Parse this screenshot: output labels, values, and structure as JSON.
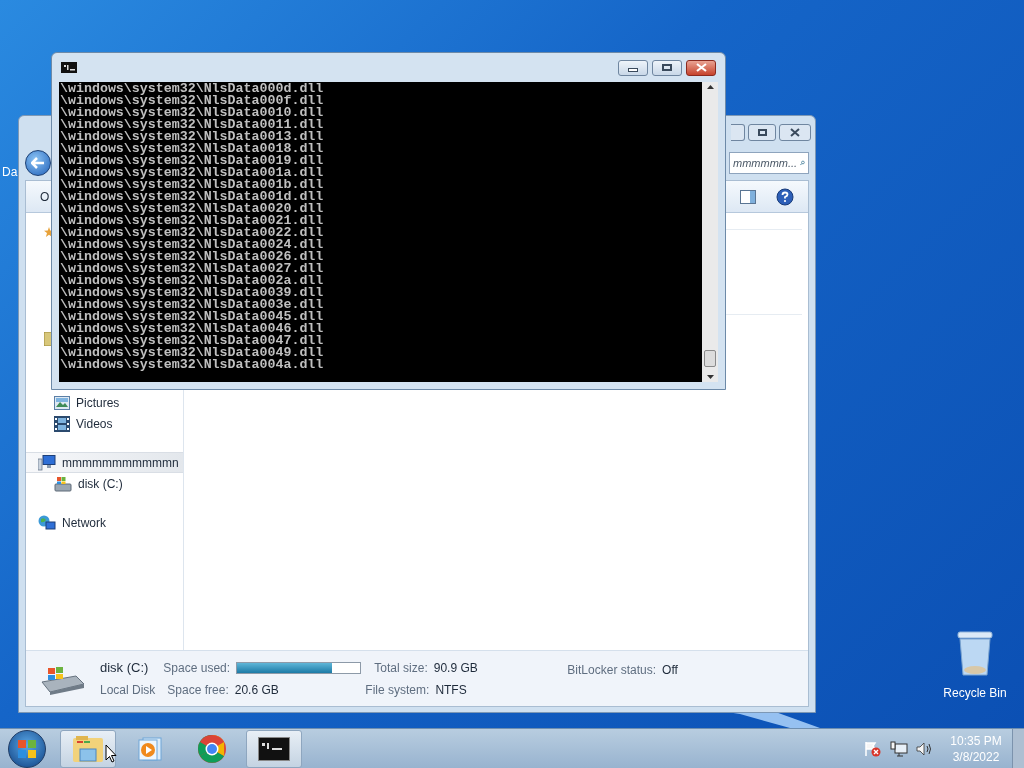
{
  "desktop": {
    "icons": [
      {
        "kind": "partial",
        "label": "Da"
      },
      {
        "kind": "recycle",
        "label": "Recycle Bin"
      }
    ]
  },
  "explorer": {
    "search": {
      "placeholder": "mmmmmm..."
    },
    "toolbar": {
      "first_button": "O"
    },
    "nav": [
      {
        "kind": "pictures",
        "label": "Pictures",
        "selected": false
      },
      {
        "kind": "videos",
        "label": "Videos",
        "selected": false
      },
      {
        "kind": "computer",
        "label": "mmmmmmmmmmmn",
        "selected": true
      },
      {
        "kind": "disk",
        "label": "disk (C:)",
        "selected": false
      },
      {
        "kind": "network",
        "label": "Network",
        "selected": false
      }
    ],
    "details": {
      "name": "disk (C:)",
      "type": "Local Disk",
      "space_used": {
        "label": "Space used:",
        "level": 0.77
      },
      "space_free": {
        "label": "Space free:",
        "value": "20.6 GB"
      },
      "total_size": {
        "label": "Total size:",
        "value": "90.9 GB"
      },
      "file_system": {
        "label": "File system:",
        "value": "NTFS"
      },
      "bitlocker": {
        "label": "BitLocker status:",
        "value": "Off"
      }
    }
  },
  "console": {
    "lines": [
      "\\windows\\system32\\NlsData000d.dll",
      "\\windows\\system32\\NlsData000f.dll",
      "\\windows\\system32\\NlsData0010.dll",
      "\\windows\\system32\\NlsData0011.dll",
      "\\windows\\system32\\NlsData0013.dll",
      "\\windows\\system32\\NlsData0018.dll",
      "\\windows\\system32\\NlsData0019.dll",
      "\\windows\\system32\\NlsData001a.dll",
      "\\windows\\system32\\NlsData001b.dll",
      "\\windows\\system32\\NlsData001d.dll",
      "\\windows\\system32\\NlsData0020.dll",
      "\\windows\\system32\\NlsData0021.dll",
      "\\windows\\system32\\NlsData0022.dll",
      "\\windows\\system32\\NlsData0024.dll",
      "\\windows\\system32\\NlsData0026.dll",
      "\\windows\\system32\\NlsData0027.dll",
      "\\windows\\system32\\NlsData002a.dll",
      "\\windows\\system32\\NlsData0039.dll",
      "\\windows\\system32\\NlsData003e.dll",
      "\\windows\\system32\\NlsData0045.dll",
      "\\windows\\system32\\NlsData0046.dll",
      "\\windows\\system32\\NlsData0047.dll",
      "\\windows\\system32\\NlsData0049.dll",
      "\\windows\\system32\\NlsData004a.dll"
    ]
  },
  "taskbar": {
    "buttons": [
      {
        "kind": "explorer",
        "selected": true
      },
      {
        "kind": "media",
        "selected": false
      },
      {
        "kind": "chrome",
        "selected": false
      },
      {
        "kind": "cmd",
        "selected": true
      }
    ],
    "clock": {
      "time": "10:35 PM",
      "date": "3/8/2022"
    }
  }
}
